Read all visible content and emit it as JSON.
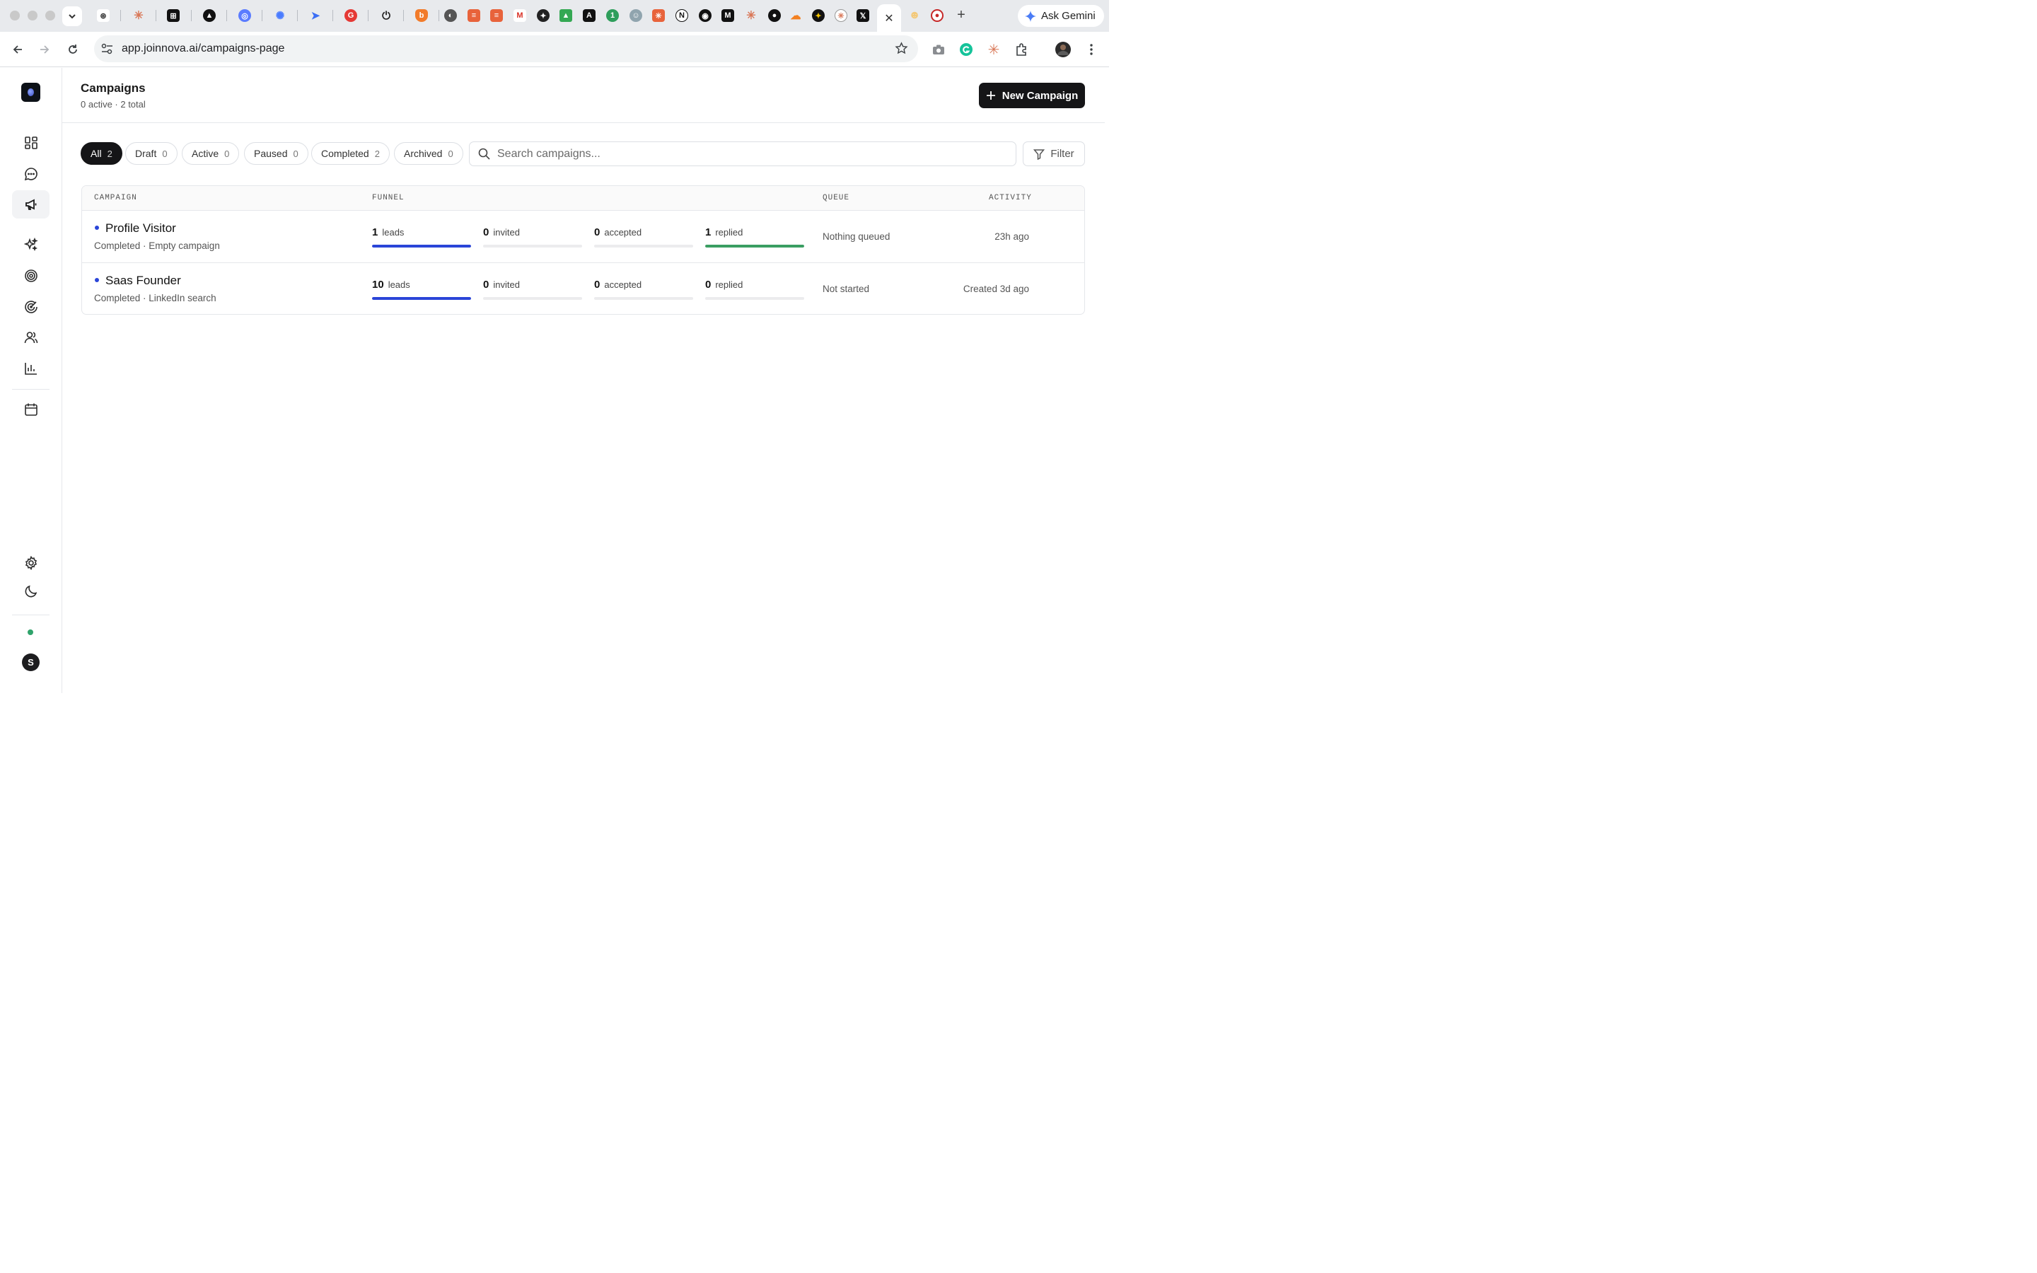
{
  "browser": {
    "url": "app.joinnova.ai/campaigns-page",
    "gemini_label": "Ask Gemini",
    "tab_icons": [
      "openai-icon",
      "claude-icon",
      "notion-like-icon",
      "triangle-icon",
      "chatgpt-icon",
      "loader-icon",
      "arrow-icon",
      "chrome-extension-icon",
      "power-icon",
      "brave-icon",
      "globe-icon",
      "todoist-icon",
      "todoist-icon",
      "gmail-icon",
      "perplexity-icon",
      "drive-icon",
      "a-icon",
      "one-icon",
      "robot-icon",
      "claude-icon",
      "notion-icon",
      "github-icon",
      "medium-icon",
      "claude-icon",
      "circle-icon",
      "cloudflare-icon",
      "star-icon",
      "claude-icon",
      "x-icon",
      "active-tab-close-icon",
      "cookie-icon",
      "record-icon"
    ]
  },
  "sidebar": {
    "items": [
      {
        "name": "dashboard"
      },
      {
        "name": "messages"
      },
      {
        "name": "campaigns",
        "active": true
      },
      {
        "name": "ai-sparkles"
      },
      {
        "name": "targets"
      },
      {
        "name": "radar"
      },
      {
        "name": "contacts"
      },
      {
        "name": "analytics"
      },
      {
        "name": "calendar"
      }
    ],
    "avatar_initial": "S",
    "status_color": "#2fa36b"
  },
  "header": {
    "title": "Campaigns",
    "subtitle": "0 active · 2 total",
    "new_button": "New Campaign"
  },
  "filters": [
    {
      "label": "All",
      "count": "2",
      "active": true
    },
    {
      "label": "Draft",
      "count": "0"
    },
    {
      "label": "Active",
      "count": "0"
    },
    {
      "label": "Paused",
      "count": "0"
    },
    {
      "label": "Completed",
      "count": "2"
    },
    {
      "label": "Archived",
      "count": "0"
    }
  ],
  "search": {
    "placeholder": "Search campaigns..."
  },
  "filter_button": "Filter",
  "table": {
    "columns": [
      "CAMPAIGN",
      "FUNNEL",
      "QUEUE",
      "ACTIVITY"
    ],
    "rows": [
      {
        "name": "Profile Visitor",
        "meta": "Completed · Empty campaign",
        "leads": "1",
        "leads_label": "leads",
        "leads_fill": 1.0,
        "invited": "0",
        "invited_label": "invited",
        "invited_fill": 0,
        "accepted": "0",
        "accepted_label": "accepted",
        "accepted_fill": 0,
        "replied": "1",
        "replied_label": "replied",
        "replied_fill": 1.0,
        "queue": "Nothing queued",
        "activity": "23h ago"
      },
      {
        "name": "Saas Founder",
        "meta": "Completed · LinkedIn search",
        "leads": "10",
        "leads_label": "leads",
        "leads_fill": 1.0,
        "invited": "0",
        "invited_label": "invited",
        "invited_fill": 0,
        "accepted": "0",
        "accepted_label": "accepted",
        "accepted_fill": 0,
        "replied": "0",
        "replied_label": "replied",
        "replied_fill": 0,
        "queue": "Not started",
        "activity": "Created 3d ago"
      }
    ]
  },
  "colors": {
    "leads_bar": "#2a45d8",
    "replied_bar": "#3a9e62",
    "dot": "#2a45d8"
  }
}
